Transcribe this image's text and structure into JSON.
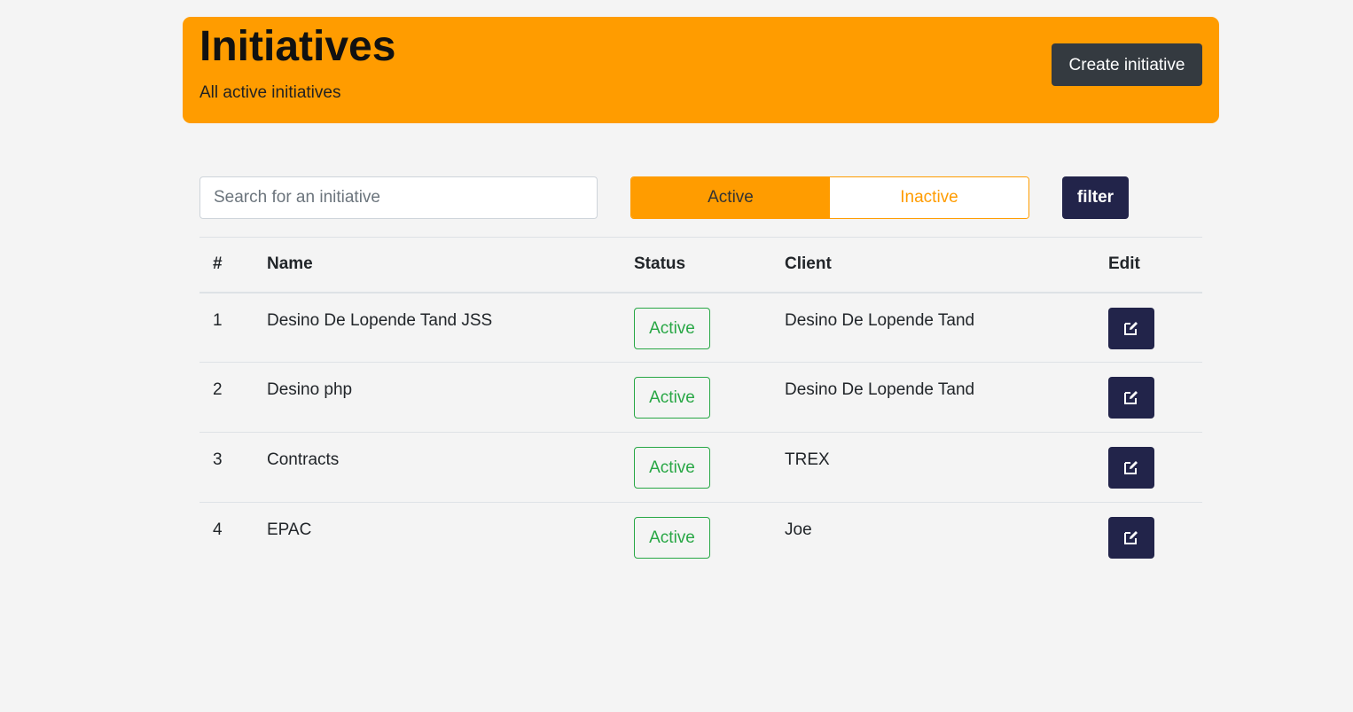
{
  "header": {
    "title": "Initiatives",
    "subtitle": "All active initiatives",
    "create_label": "Create initiative"
  },
  "search": {
    "placeholder": "Search for an initiative",
    "value": ""
  },
  "toggle": {
    "active_label": "Active",
    "inactive_label": "Inactive",
    "selected": "Active"
  },
  "filter_label": "filter",
  "colors": {
    "accent": "#ff9c00",
    "dark_button": "#343a40",
    "navy_button": "#22244a",
    "status_green": "#28a745"
  },
  "table": {
    "headers": {
      "num": "#",
      "name": "Name",
      "status": "Status",
      "client": "Client",
      "edit": "Edit"
    },
    "rows": [
      {
        "num": "1",
        "name": "Desino De Lopende Tand JSS",
        "status": "Active",
        "client": "Desino De Lopende Tand",
        "edit_icon": "edit-icon"
      },
      {
        "num": "2",
        "name": "Desino php",
        "status": "Active",
        "client": "Desino De Lopende Tand",
        "edit_icon": "edit-icon"
      },
      {
        "num": "3",
        "name": "Contracts",
        "status": "Active",
        "client": "TREX",
        "edit_icon": "edit-icon"
      },
      {
        "num": "4",
        "name": "EPAC",
        "status": "Active",
        "client": "Joe",
        "edit_icon": "edit-icon"
      }
    ]
  }
}
